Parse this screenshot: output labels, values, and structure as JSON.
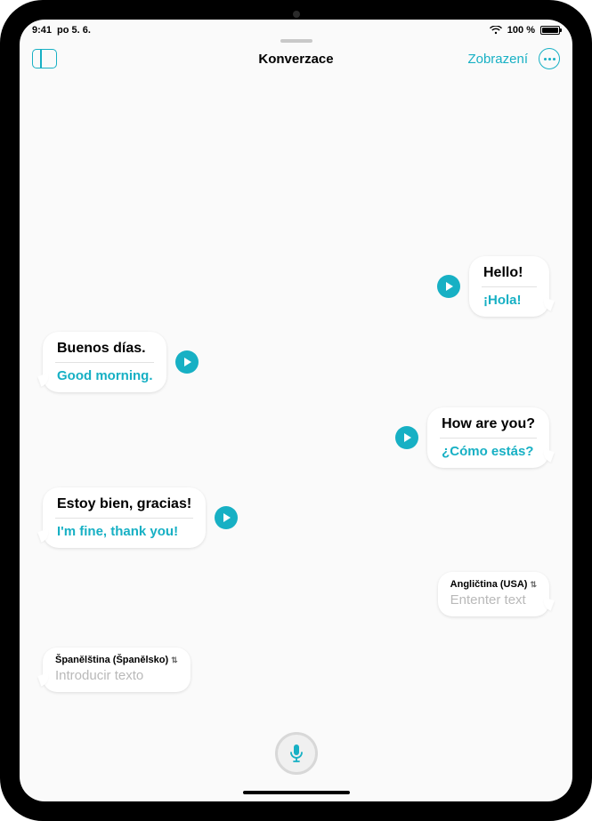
{
  "colors": {
    "accent": "#17b0c4"
  },
  "status": {
    "time": "9:41",
    "date": "po 5. 6.",
    "battery_pct": "100 %"
  },
  "nav": {
    "title": "Konverzace",
    "view_label": "Zobrazení"
  },
  "messages": [
    {
      "side": "right",
      "original": "Hello!",
      "translation": "¡Hola!"
    },
    {
      "side": "left",
      "original": "Buenos días.",
      "translation": "Good morning."
    },
    {
      "side": "right",
      "original": "How are you?",
      "translation": "¿Cómo estás?"
    },
    {
      "side": "left",
      "original": "Estoy bien, gracias!",
      "translation": "I'm fine, thank you!"
    }
  ],
  "inputs": {
    "right": {
      "language": "Angličtina (USA)",
      "placeholder": "Ententer text"
    },
    "left": {
      "language": "Španělština (Španělsko)",
      "placeholder": "Introducir texto"
    }
  }
}
